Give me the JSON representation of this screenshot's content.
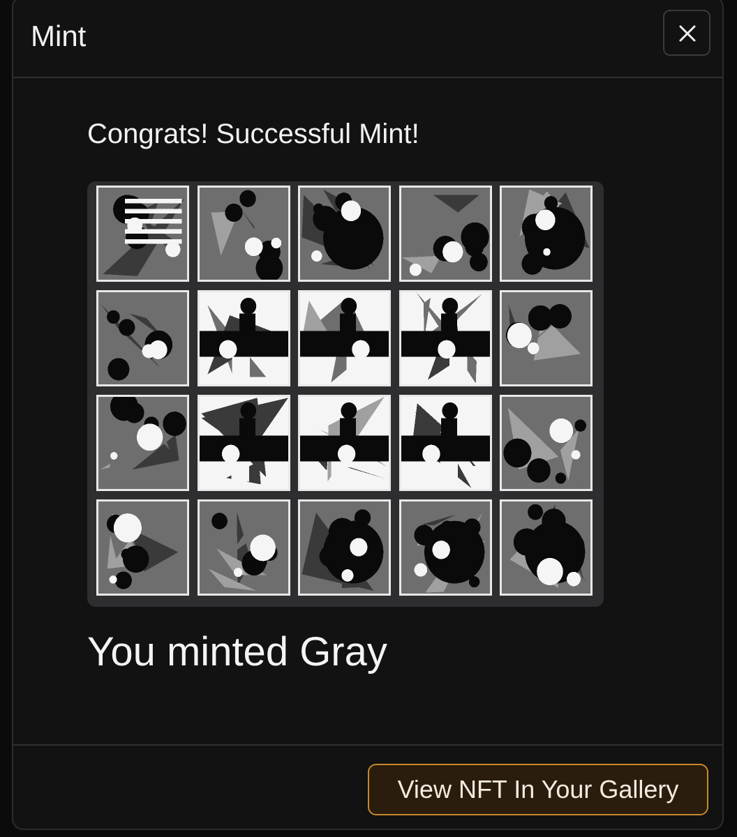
{
  "modal": {
    "title": "Mint",
    "close_icon": "close-icon",
    "congrats_text": "Congrats! Successful Mint!",
    "minted_text": "You minted Gray",
    "gallery_button_label": "View NFT In Your Gallery"
  },
  "nft_grid": {
    "rows": 4,
    "columns": 5,
    "palette": [
      "#0a0a0a",
      "#3a3a3a",
      "#6e6e6e",
      "#a0a0a0",
      "#f5f5f5"
    ]
  },
  "colors": {
    "background": "#121212",
    "button_border": "#c7882f",
    "button_fill": "#2b1d0e"
  }
}
